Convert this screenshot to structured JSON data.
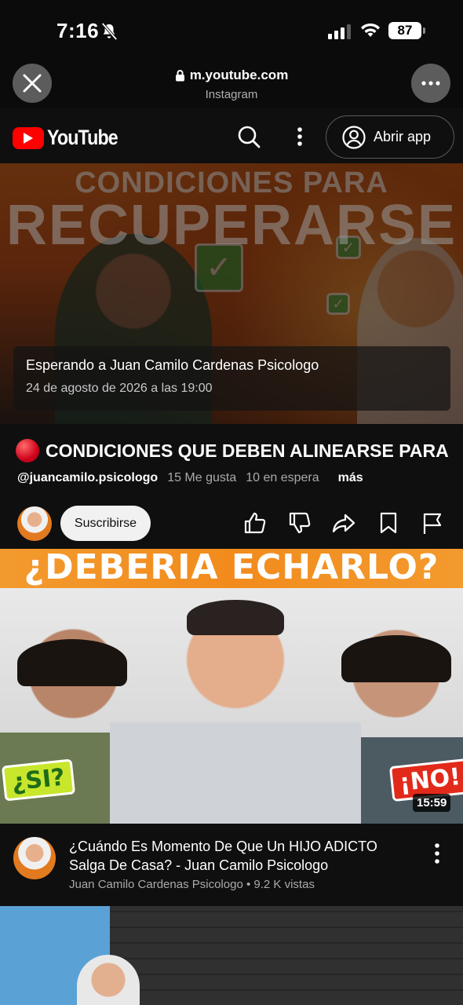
{
  "status_bar": {
    "time": "7:16",
    "battery": "87",
    "bell_icon": "bell-slash-icon",
    "signal_icon": "cellular-signal-icon",
    "wifi_icon": "wifi-icon"
  },
  "browser": {
    "url": "m.youtube.com",
    "source_app": "Instagram",
    "close_icon": "close-icon",
    "more_icon": "more-horizontal-icon",
    "lock_icon": "lock-icon"
  },
  "yt_header": {
    "logo_text": "YouTube",
    "open_app_label": "Abrir app",
    "brand_red": "#ff0000"
  },
  "live_video": {
    "thumbnail_line1": "CONDICIONES PARA",
    "thumbnail_line2": "RECUPERARSE",
    "waiting_text": "Esperando a Juan Camilo Cardenas Psicologo",
    "scheduled_date": "24 de agosto de 2026 a las 19:00",
    "title": "CONDICIONES QUE DEBEN ALINEARSE PARA",
    "channel_handle": "@juancamilo.psicologo",
    "likes": "15 Me gusta",
    "waiting_count": "10 en espera",
    "more_label": "más",
    "subscribe_label": "Suscribirse"
  },
  "second_video": {
    "thumbnail_text": "¿DEBERIA ECHARLO?",
    "tag_left": "¿SI?",
    "tag_right": "¡NO!",
    "duration": "15:59",
    "title": "¿Cuándo Es Momento De Que Un HIJO ADICTO Salga De Casa? - Juan Camilo Psicologo",
    "channel": "Juan Camilo Cardenas Psicologo",
    "separator": "•",
    "views": "9.2 K vistas"
  }
}
